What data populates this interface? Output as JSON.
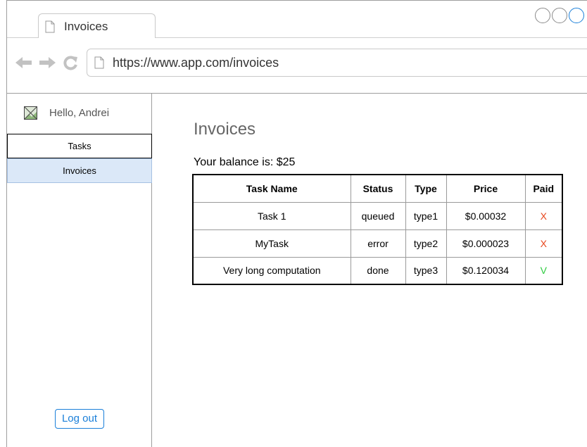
{
  "browser": {
    "tab_title": "Invoices",
    "url": "https://www.app.com/invoices",
    "nav_icons": [
      "back-arrow-icon",
      "forward-arrow-icon",
      "reload-icon"
    ]
  },
  "sidebar": {
    "greeting": "Hello, Andrei",
    "items": [
      {
        "label": "Tasks",
        "active": false
      },
      {
        "label": "Invoices",
        "active": true
      }
    ],
    "logout_label": "Log out"
  },
  "main": {
    "title": "Invoices",
    "balance_text": "Your balance is: $25",
    "table": {
      "headers": [
        "Task Name",
        "Status",
        "Type",
        "Price",
        "Paid"
      ],
      "rows": [
        [
          "Task 1",
          "queued",
          "type1",
          "$0.00032",
          "X"
        ],
        [
          "MyTask",
          "error",
          "type2",
          "$0.000023",
          "X"
        ],
        [
          "Very long computation",
          "done",
          "type3",
          "$0.120034",
          "V"
        ]
      ]
    }
  },
  "colors": {
    "accent": "#1a7fd9",
    "unpaid": "#e8461c",
    "paid": "#2ecc40",
    "active_menu_bg": "#dbe8f8"
  }
}
